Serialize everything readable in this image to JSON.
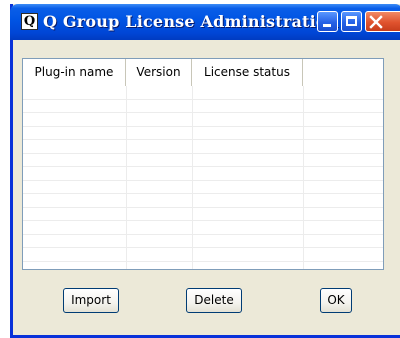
{
  "window": {
    "title": "Q Group License Administration",
    "icon_letter": "Q"
  },
  "list": {
    "columns": [
      "Plug-in name",
      "Version",
      "License status"
    ],
    "rows": []
  },
  "buttons": {
    "import": "Import",
    "delete": "Delete",
    "ok": "OK"
  }
}
